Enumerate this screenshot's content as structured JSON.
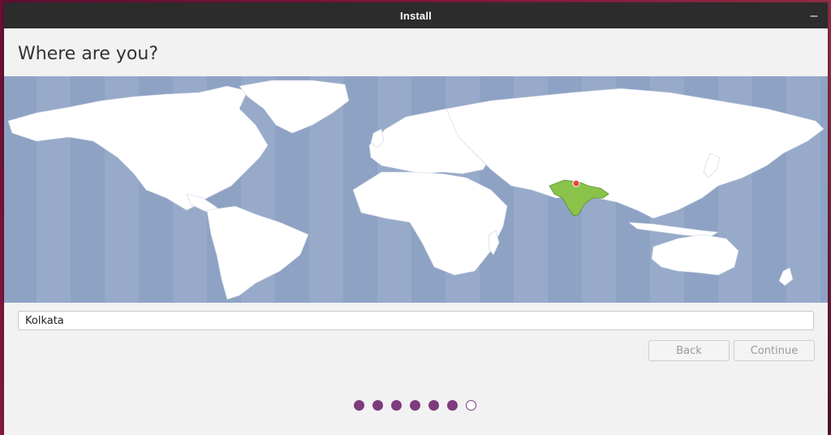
{
  "window": {
    "title": "Install",
    "minimize_glyph": "–"
  },
  "page": {
    "heading": "Where are you?"
  },
  "map": {
    "ocean_color": "#8ea2c4",
    "land_color": "#ffffff",
    "selected_region_color": "#8bc34a",
    "marker_color": "#e8453c",
    "icon": "world-map"
  },
  "location": {
    "value": "Kolkata"
  },
  "buttons": {
    "back": "Back",
    "continue": "Continue"
  },
  "progress": {
    "total_steps": 7,
    "completed_steps": 6,
    "accent_color": "#7d3c7d"
  }
}
